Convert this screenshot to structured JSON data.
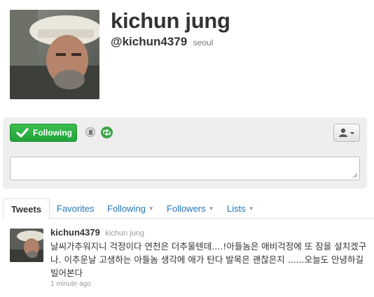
{
  "profile": {
    "display_name": "kichun jung",
    "handle": "@kichun4379",
    "location": "seoul"
  },
  "actions": {
    "following_label": "Following",
    "tweet_box_placeholder": ""
  },
  "tabs": [
    {
      "label": "Tweets",
      "active": true
    },
    {
      "label": "Favorites"
    },
    {
      "label": "Following",
      "dropdown": true
    },
    {
      "label": "Followers",
      "dropdown": true
    },
    {
      "label": "Lists",
      "dropdown": true
    }
  ],
  "tweet": {
    "handle": "kichun4379",
    "name": "kichun jung",
    "text": "날씨가추워지니 걱정이다 연천은 더추울텐데....!아들놈은 애비걱정에 또 잠을 설치겠구나. 이추운날 고생하는 아들놈 생각에 애가 탄다 발목은 괜찮은지 ......오늘도 안녕하길 빌어본다",
    "time": "1 minute ago"
  },
  "colors": {
    "follow_green": "#2db744",
    "link_blue": "#2276bb",
    "panel_gray": "#eeeeee"
  },
  "icons": [
    "check-icon",
    "device-icon",
    "retweet-icon",
    "user-icon",
    "caret-down-icon"
  ]
}
